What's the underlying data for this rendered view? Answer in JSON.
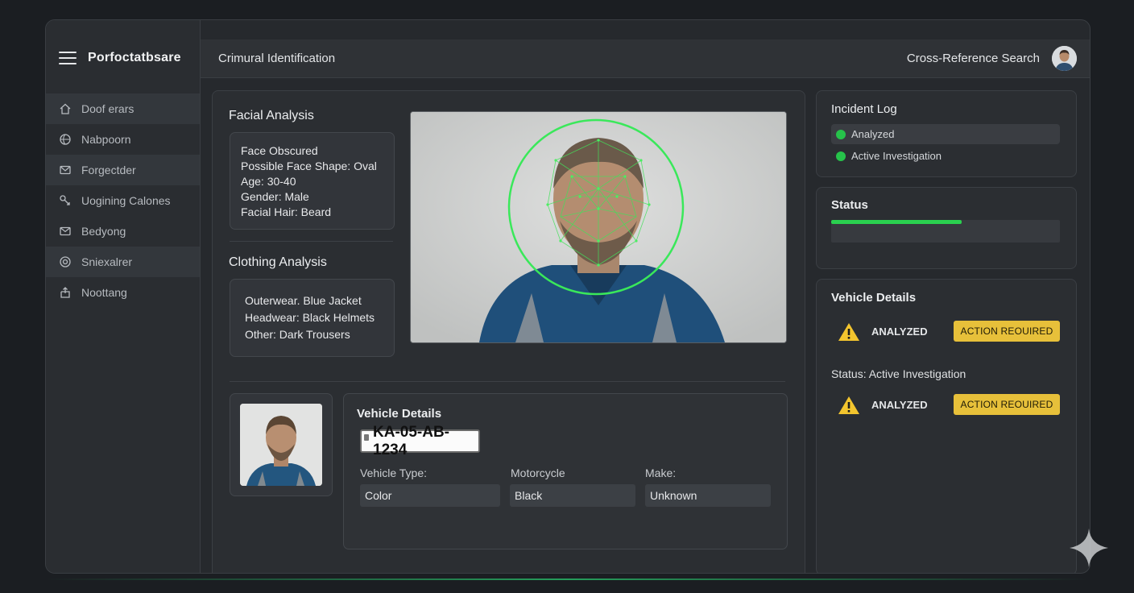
{
  "window": {
    "traffic_colors": [
      "#ff5f57",
      "#febc2e",
      "#28c840"
    ]
  },
  "app": {
    "brand_name": "Porfoctatbsare"
  },
  "sidebar": {
    "items": [
      {
        "label": "Doof erars",
        "icon": "home-icon"
      },
      {
        "label": "Nabpoorn",
        "icon": "globe-icon"
      },
      {
        "label": "Forgectder",
        "icon": "mail-icon"
      },
      {
        "label": "Uogining Calones",
        "icon": "link-icon"
      },
      {
        "label": "Bedyong",
        "icon": "envelope-icon"
      },
      {
        "label": "Sniexalrer",
        "icon": "target-icon"
      },
      {
        "label": "Noottang",
        "icon": "share-icon"
      }
    ]
  },
  "header": {
    "title": "Crimural Identification",
    "cross_reference": "Cross-Reference Search"
  },
  "facial": {
    "title": "Facial Analysis",
    "lines": [
      "Face Obscured",
      "Possible Face Shape: Oval",
      "Age: 30-40",
      "Gender: Male",
      "Facial Hair: Beard"
    ]
  },
  "clothing": {
    "title": "Clothing Analysis",
    "lines": [
      "Outerwear. Blue Jacket",
      "Headwear: Black Helmets",
      "Other: Dark Trousers"
    ]
  },
  "vehicle": {
    "title": "Vehicle Details",
    "plate": "KA-05-AB-1234",
    "labels": [
      "Vehicle Type:",
      "Motorcycle",
      "Make:"
    ],
    "values": [
      "Color",
      "Black",
      "Unknown"
    ]
  },
  "incident_log": {
    "title": "Incident Log",
    "items": [
      "Analyzed",
      "Active Investigation"
    ],
    "dot_color": "#26c24a"
  },
  "status": {
    "title": "Status",
    "progress": 0.57,
    "progress_color": "#2ad04f"
  },
  "vehicle_panel": {
    "title": "Vehicle Details",
    "status_text": "Status: Active Investigation",
    "analyzed": "ANALYZED",
    "action": "ACTION REOUIRED",
    "accent": "#e7c03a"
  }
}
